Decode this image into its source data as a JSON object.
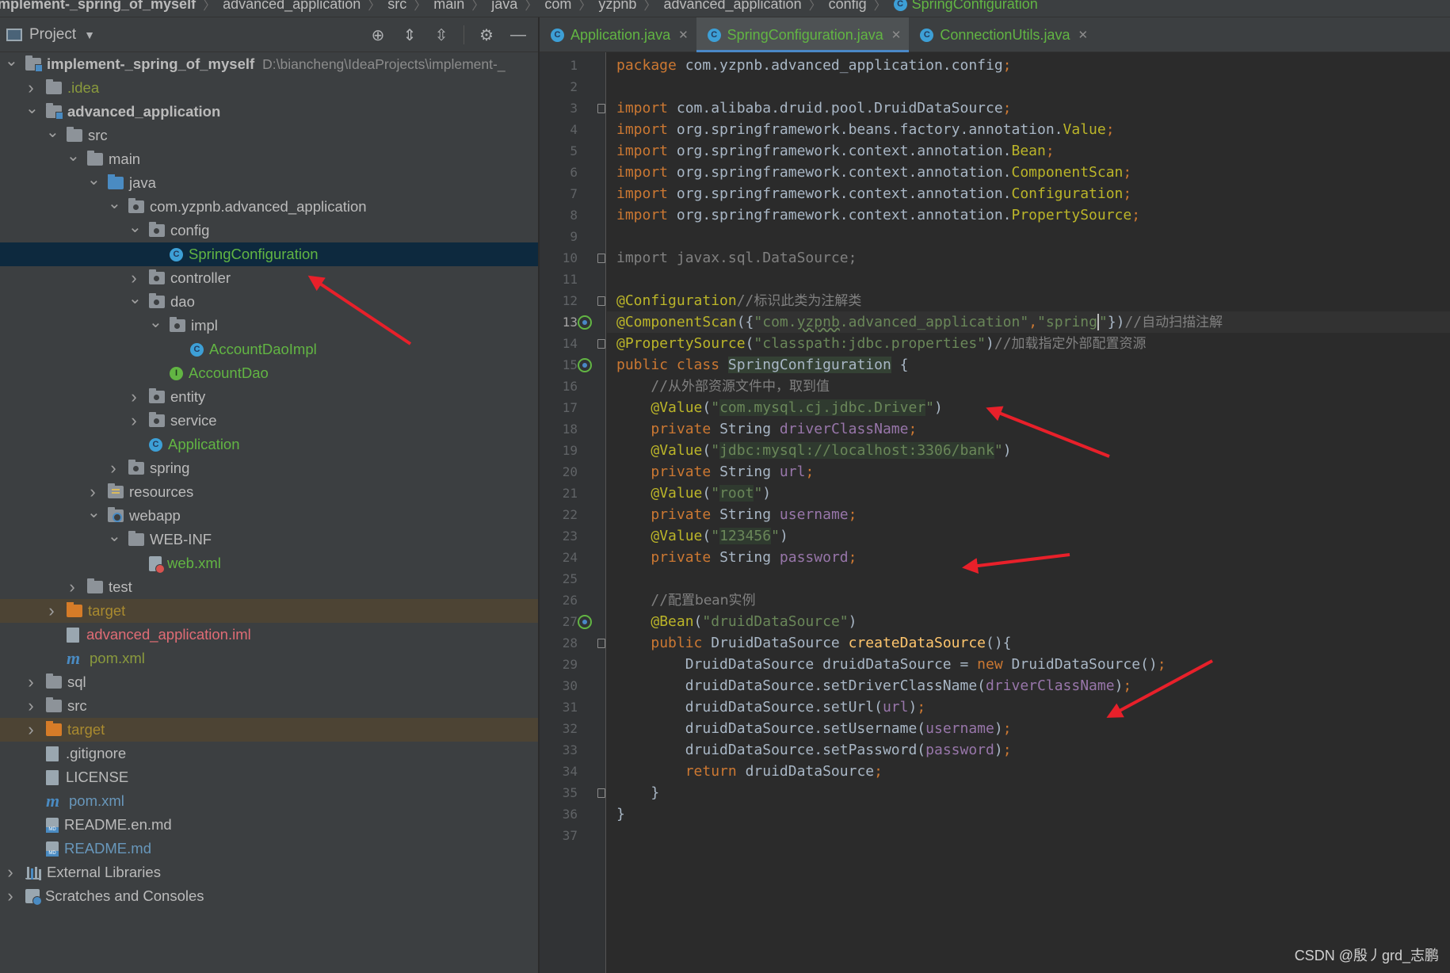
{
  "breadcrumb": [
    "implement-_spring_of_myself",
    "advanced_application",
    "src",
    "main",
    "java",
    "com",
    "yzpnb",
    "advanced_application",
    "config",
    "SpringConfiguration"
  ],
  "project_panel": {
    "title": "Project",
    "tools": [
      "locate-icon",
      "expand-all-icon",
      "collapse-all-icon",
      "settings-icon",
      "hide-icon"
    ]
  },
  "tree": [
    {
      "label": "implement-_spring_of_myself",
      "path": "D:\\biancheng\\IdeaProjects\\implement-_",
      "depth": 0,
      "arrow": "open",
      "icon": "module-folder",
      "style": "bold"
    },
    {
      "label": ".idea",
      "depth": 1,
      "arrow": "closed",
      "icon": "folder",
      "style": "olive"
    },
    {
      "label": "advanced_application",
      "depth": 1,
      "arrow": "open",
      "icon": "module-folder",
      "style": "bold"
    },
    {
      "label": "src",
      "depth": 2,
      "arrow": "open",
      "icon": "folder"
    },
    {
      "label": "main",
      "depth": 3,
      "arrow": "open",
      "icon": "folder"
    },
    {
      "label": "java",
      "depth": 4,
      "arrow": "open",
      "icon": "source-folder"
    },
    {
      "label": "com.yzpnb.advanced_application",
      "depth": 5,
      "arrow": "open",
      "icon": "package-folder"
    },
    {
      "label": "config",
      "depth": 6,
      "arrow": "open",
      "icon": "package-folder"
    },
    {
      "label": "SpringConfiguration",
      "depth": 7,
      "arrow": "none",
      "icon": "class",
      "style": "green",
      "selected": true
    },
    {
      "label": "controller",
      "depth": 6,
      "arrow": "closed",
      "icon": "package-folder"
    },
    {
      "label": "dao",
      "depth": 6,
      "arrow": "open",
      "icon": "package-folder"
    },
    {
      "label": "impl",
      "depth": 7,
      "arrow": "open",
      "icon": "package-folder"
    },
    {
      "label": "AccountDaoImpl",
      "depth": 8,
      "arrow": "none",
      "icon": "class",
      "style": "green"
    },
    {
      "label": "AccountDao",
      "depth": 7,
      "arrow": "none",
      "icon": "interface",
      "style": "green"
    },
    {
      "label": "entity",
      "depth": 6,
      "arrow": "closed",
      "icon": "package-folder"
    },
    {
      "label": "service",
      "depth": 6,
      "arrow": "closed",
      "icon": "package-folder"
    },
    {
      "label": "Application",
      "depth": 6,
      "arrow": "none",
      "icon": "class-runnable",
      "style": "green"
    },
    {
      "label": "spring",
      "depth": 5,
      "arrow": "closed",
      "icon": "package-folder"
    },
    {
      "label": "resources",
      "depth": 4,
      "arrow": "closed",
      "icon": "resources-folder"
    },
    {
      "label": "webapp",
      "depth": 4,
      "arrow": "open",
      "icon": "web-folder"
    },
    {
      "label": "WEB-INF",
      "depth": 5,
      "arrow": "open",
      "icon": "folder"
    },
    {
      "label": "web.xml",
      "depth": 6,
      "arrow": "none",
      "icon": "xml-file",
      "style": "green"
    },
    {
      "label": "test",
      "depth": 3,
      "arrow": "closed",
      "icon": "folder"
    },
    {
      "label": "target",
      "depth": 2,
      "arrow": "closed",
      "icon": "excluded-folder",
      "style": "ignored",
      "excluded": true
    },
    {
      "label": "advanced_application.iml",
      "depth": 2,
      "arrow": "none",
      "icon": "iml-file",
      "style": "red"
    },
    {
      "label": "pom.xml",
      "depth": 2,
      "arrow": "none",
      "icon": "maven-file",
      "style": "olive"
    },
    {
      "label": "sql",
      "depth": 1,
      "arrow": "closed",
      "icon": "folder"
    },
    {
      "label": "src",
      "depth": 1,
      "arrow": "closed",
      "icon": "folder"
    },
    {
      "label": "target",
      "depth": 1,
      "arrow": "closed",
      "icon": "excluded-folder",
      "style": "ignored",
      "excluded": true
    },
    {
      "label": ".gitignore",
      "depth": 1,
      "arrow": "none",
      "icon": "gitignore-file"
    },
    {
      "label": "LICENSE",
      "depth": 1,
      "arrow": "none",
      "icon": "text-file"
    },
    {
      "label": "pom.xml",
      "depth": 1,
      "arrow": "none",
      "icon": "maven-file",
      "style": "blue"
    },
    {
      "label": "README.en.md",
      "depth": 1,
      "arrow": "none",
      "icon": "markdown-file"
    },
    {
      "label": "README.md",
      "depth": 1,
      "arrow": "none",
      "icon": "markdown-file",
      "style": "blue"
    },
    {
      "label": "External Libraries",
      "depth": 0,
      "arrow": "closed",
      "icon": "libraries"
    },
    {
      "label": "Scratches and Consoles",
      "depth": 0,
      "arrow": "closed",
      "icon": "scratches"
    }
  ],
  "tabs": [
    {
      "label": "Application.java",
      "active": false
    },
    {
      "label": "SpringConfiguration.java",
      "active": true
    },
    {
      "label": "ConnectionUtils.java",
      "active": false
    }
  ],
  "editor": {
    "current_line": 13,
    "gutter_marks": [
      13,
      15,
      27
    ],
    "fold_marks": [
      3,
      10,
      12,
      14,
      28,
      35
    ],
    "lines": [
      [
        [
          "kw",
          "package "
        ],
        [
          "",
          "com.yzpnb.advanced_application.config"
        ],
        [
          "kw",
          ";"
        ]
      ],
      [],
      [
        [
          "kw",
          "import "
        ],
        [
          "",
          "com.alibaba.druid.pool.DruidDataSource"
        ],
        [
          "kw",
          ";"
        ]
      ],
      [
        [
          "kw",
          "import "
        ],
        [
          "",
          "org.springframework.beans.factory.annotation."
        ],
        [
          "ann",
          "Value"
        ],
        [
          "kw",
          ";"
        ]
      ],
      [
        [
          "kw",
          "import "
        ],
        [
          "",
          "org.springframework.context.annotation."
        ],
        [
          "ann",
          "Bean"
        ],
        [
          "kw",
          ";"
        ]
      ],
      [
        [
          "kw",
          "import "
        ],
        [
          "",
          "org.springframework.context.annotation."
        ],
        [
          "ann",
          "ComponentScan"
        ],
        [
          "kw",
          ";"
        ]
      ],
      [
        [
          "kw",
          "import "
        ],
        [
          "",
          "org.springframework.context.annotation."
        ],
        [
          "ann",
          "Configuration"
        ],
        [
          "kw",
          ";"
        ]
      ],
      [
        [
          "kw",
          "import "
        ],
        [
          "",
          "org.springframework.context.annotation."
        ],
        [
          "ann",
          "PropertySource"
        ],
        [
          "kw",
          ";"
        ]
      ],
      [],
      [
        [
          "imp-unused",
          "import javax.sql.DataSource;"
        ]
      ],
      [],
      [
        [
          "ann",
          "@Configuration"
        ],
        [
          "cmt",
          "//"
        ],
        [
          "cmt cmt-cn",
          "标识此类为注解类"
        ]
      ],
      [
        [
          "ann",
          "@ComponentScan"
        ],
        [
          "",
          "({"
        ],
        [
          "str",
          "\"com."
        ],
        [
          "str wavy",
          "yzpnb"
        ],
        [
          "str",
          ".advanced_application\""
        ],
        [
          "kw",
          ","
        ],
        [
          "str",
          "\"spring"
        ],
        [
          "caret",
          ""
        ],
        [
          "str",
          "\""
        ],
        [
          "",
          "})"
        ],
        [
          "cmt",
          "//"
        ],
        [
          "cmt cmt-cn",
          "自动扫描注解"
        ]
      ],
      [
        [
          "ann",
          "@PropertySource"
        ],
        [
          "",
          "("
        ],
        [
          "str",
          "\"classpath:jdbc.properties\""
        ],
        [
          "",
          ")"
        ],
        [
          "cmt",
          "//"
        ],
        [
          "cmt cmt-cn",
          "加载指定外部配置资源"
        ]
      ],
      [
        [
          "kw",
          "public class "
        ],
        [
          "clsdecl",
          "SpringConfiguration"
        ],
        [
          "",
          " {"
        ]
      ],
      [
        [
          "",
          "    "
        ],
        [
          "cmt",
          "//"
        ],
        [
          "cmt cmt-cn",
          "从外部资源文件中，取到值"
        ]
      ],
      [
        [
          "",
          "    "
        ],
        [
          "ann",
          "@Value"
        ],
        [
          "",
          "("
        ],
        [
          "str",
          "\""
        ],
        [
          "str strbg",
          "com.mysql.cj.jdbc.Driver"
        ],
        [
          "str",
          "\""
        ],
        [
          "",
          ")"
        ]
      ],
      [
        [
          "",
          "    "
        ],
        [
          "kw",
          "private "
        ],
        [
          "",
          "String "
        ],
        [
          "fld",
          "driverClassName"
        ],
        [
          "kw",
          ";"
        ]
      ],
      [
        [
          "",
          "    "
        ],
        [
          "ann",
          "@Value"
        ],
        [
          "",
          "("
        ],
        [
          "str",
          "\""
        ],
        [
          "str strbg",
          "jdbc:mysql://localhost:3306/bank"
        ],
        [
          "str",
          "\""
        ],
        [
          "",
          ")"
        ]
      ],
      [
        [
          "",
          "    "
        ],
        [
          "kw",
          "private "
        ],
        [
          "",
          "String "
        ],
        [
          "fld",
          "url"
        ],
        [
          "kw",
          ";"
        ]
      ],
      [
        [
          "",
          "    "
        ],
        [
          "ann",
          "@Value"
        ],
        [
          "",
          "("
        ],
        [
          "str",
          "\""
        ],
        [
          "str strbg",
          "root"
        ],
        [
          "str",
          "\""
        ],
        [
          "",
          ")"
        ]
      ],
      [
        [
          "",
          "    "
        ],
        [
          "kw",
          "private "
        ],
        [
          "",
          "String "
        ],
        [
          "fld",
          "username"
        ],
        [
          "kw",
          ";"
        ]
      ],
      [
        [
          "",
          "    "
        ],
        [
          "ann",
          "@Value"
        ],
        [
          "",
          "("
        ],
        [
          "str",
          "\""
        ],
        [
          "str strbg",
          "123456"
        ],
        [
          "str",
          "\""
        ],
        [
          "",
          ")"
        ]
      ],
      [
        [
          "",
          "    "
        ],
        [
          "kw",
          "private "
        ],
        [
          "",
          "String "
        ],
        [
          "fld",
          "password"
        ],
        [
          "kw",
          ";"
        ]
      ],
      [],
      [
        [
          "",
          "    "
        ],
        [
          "cmt",
          "//"
        ],
        [
          "cmt cmt-cn",
          "配置bean实例"
        ]
      ],
      [
        [
          "",
          "    "
        ],
        [
          "ann",
          "@Bean"
        ],
        [
          "",
          "("
        ],
        [
          "str",
          "\"druidDataSource\""
        ],
        [
          "",
          ")"
        ]
      ],
      [
        [
          "",
          "    "
        ],
        [
          "kw",
          "public "
        ],
        [
          "",
          "DruidDataSource "
        ],
        [
          "mth",
          "createDataSource"
        ],
        [
          "",
          "(){"
        ]
      ],
      [
        [
          "",
          "        DruidDataSource druidDataSource = "
        ],
        [
          "kw",
          "new "
        ],
        [
          "",
          "DruidDataSource()"
        ],
        [
          "kw",
          ";"
        ]
      ],
      [
        [
          "",
          "        druidDataSource.setDriverClassName("
        ],
        [
          "fld",
          "driverClassName"
        ],
        [
          "",
          ")"
        ],
        [
          "kw",
          ";"
        ]
      ],
      [
        [
          "",
          "        druidDataSource.setUrl("
        ],
        [
          "fld",
          "url"
        ],
        [
          "",
          ")"
        ],
        [
          "kw",
          ";"
        ]
      ],
      [
        [
          "",
          "        druidDataSource.setUsername("
        ],
        [
          "fld",
          "username"
        ],
        [
          "",
          ")"
        ],
        [
          "kw",
          ";"
        ]
      ],
      [
        [
          "",
          "        druidDataSource.setPassword("
        ],
        [
          "fld",
          "password"
        ],
        [
          "",
          ")"
        ],
        [
          "kw",
          ";"
        ]
      ],
      [
        [
          "",
          "        "
        ],
        [
          "kw",
          "return "
        ],
        [
          "",
          "druidDataSource"
        ],
        [
          "kw",
          ";"
        ]
      ],
      [
        [
          "",
          "    }"
        ]
      ],
      [
        [
          "",
          "}"
        ]
      ],
      []
    ]
  },
  "watermark": "CSDN @殷丿grd_志鹏",
  "colors": {
    "selection": "#0d293e",
    "annotation_arrow": "#e8202a",
    "active_tab_underline": "#4a88c7"
  }
}
